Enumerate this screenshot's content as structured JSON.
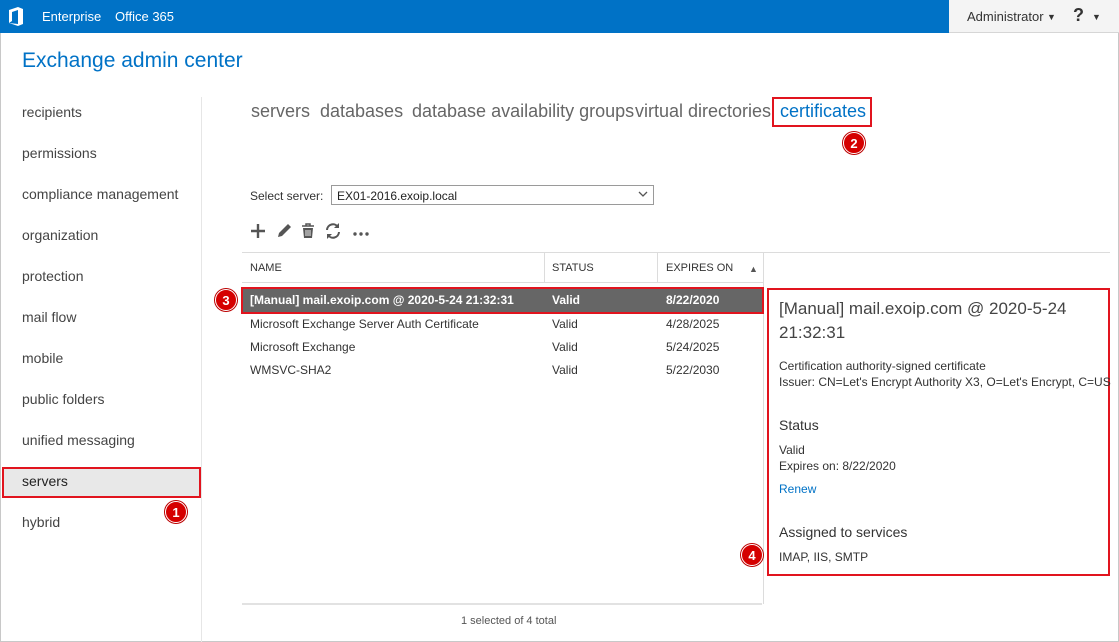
{
  "topbar": {
    "brand": "Enterprise",
    "product": "Office 365",
    "user": "Administrator",
    "help": "?"
  },
  "app": {
    "title": "Exchange admin center"
  },
  "nav": {
    "items": [
      "recipients",
      "permissions",
      "compliance management",
      "organization",
      "protection",
      "mail flow",
      "mobile",
      "public folders",
      "unified messaging",
      "servers",
      "hybrid"
    ],
    "selected": "servers"
  },
  "tabs": [
    "servers",
    "databases",
    "database availability groups",
    "virtual directories",
    "certificates"
  ],
  "active_tab": "certificates",
  "server_select": {
    "label": "Select server:",
    "value": "EX01-2016.exoip.local"
  },
  "toolbar": [
    "add-icon",
    "edit-icon",
    "delete-icon",
    "refresh-icon",
    "more-icon"
  ],
  "table": {
    "columns": [
      "NAME",
      "STATUS",
      "EXPIRES ON"
    ],
    "sort_indicator": "▲",
    "rows": [
      {
        "name": "[Manual] mail.exoip.com @ 2020-5-24 21:32:31",
        "status": "Valid",
        "expires": "8/22/2020",
        "selected": true
      },
      {
        "name": "Microsoft Exchange Server Auth Certificate",
        "status": "Valid",
        "expires": "4/28/2025"
      },
      {
        "name": "Microsoft Exchange",
        "status": "Valid",
        "expires": "5/24/2025"
      },
      {
        "name": "WMSVC-SHA2",
        "status": "Valid",
        "expires": "5/22/2030"
      }
    ]
  },
  "details": {
    "title": "[Manual] mail.exoip.com @ 2020-5-24 21:32:31",
    "type": "Certification authority-signed certificate",
    "issuer": "Issuer: CN=Let's Encrypt Authority X3, O=Let's Encrypt, C=US",
    "status_heading": "Status",
    "status_value": "Valid",
    "expires": "Expires on: 8/22/2020",
    "renew": "Renew",
    "services_heading": "Assigned to services",
    "services": "IMAP, IIS, SMTP"
  },
  "footer": {
    "text": "1 selected of 4 total"
  },
  "badges": [
    "1",
    "2",
    "3",
    "4"
  ],
  "colors": {
    "accent": "#0072c6",
    "highlight": "#e1141e",
    "badge": "#d50000",
    "selected_row": "#666666"
  }
}
